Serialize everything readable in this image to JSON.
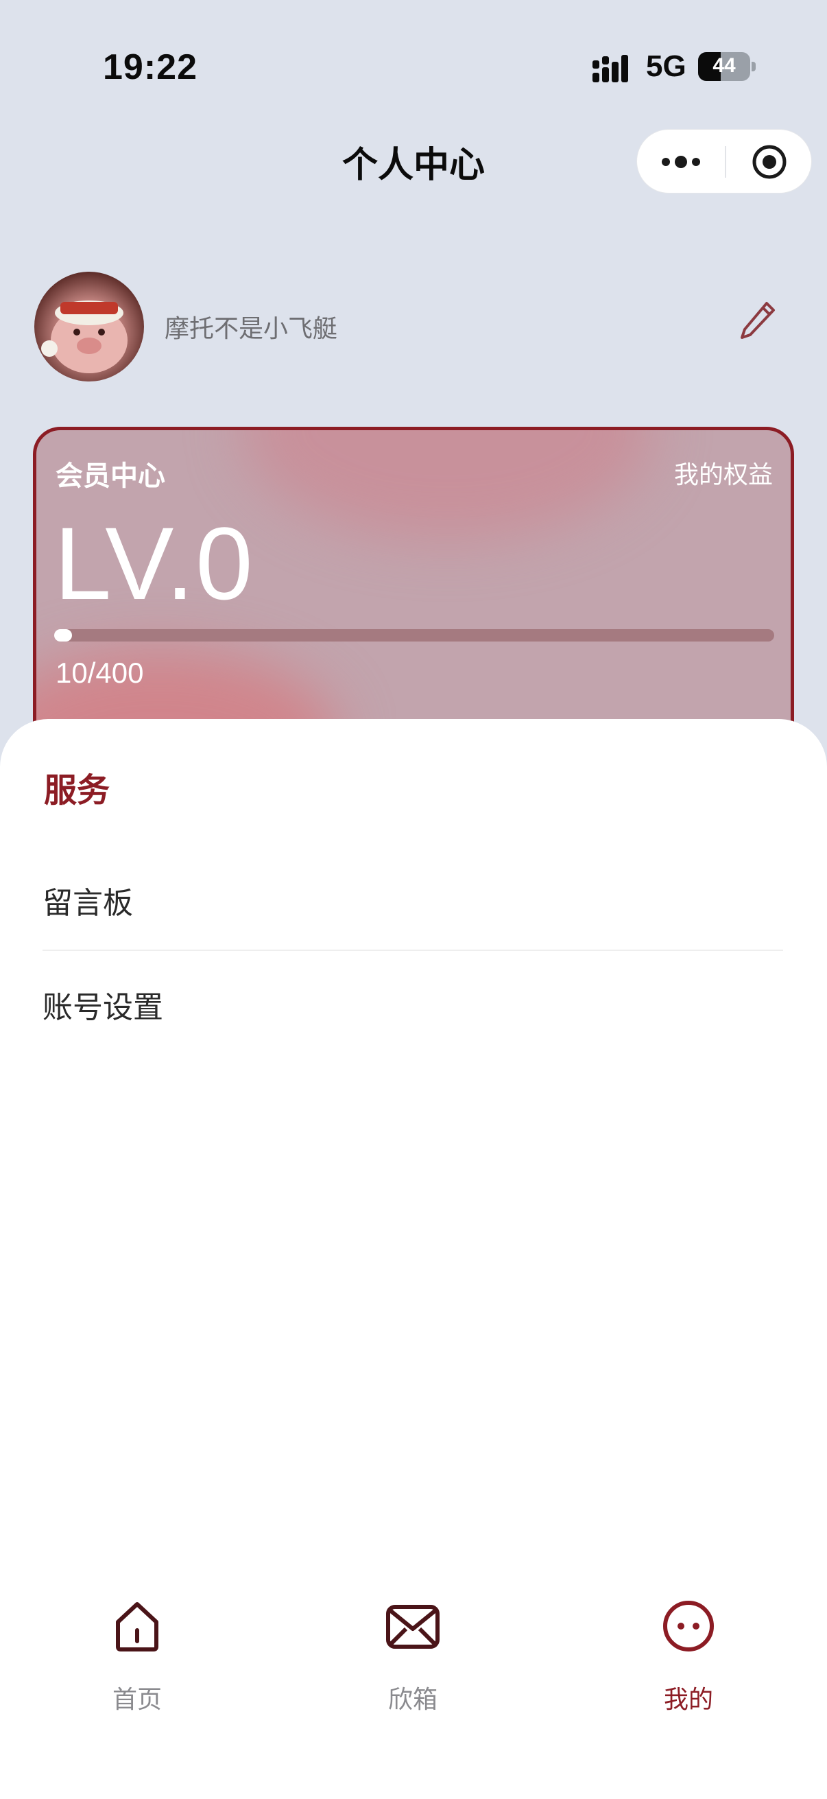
{
  "status_bar": {
    "time": "19:22",
    "network": "5G",
    "battery": "44",
    "battery_level": 0.44
  },
  "nav": {
    "title": "个人中心",
    "more_icon": "more-dots-icon",
    "close_icon": "target-close-icon"
  },
  "profile": {
    "nickname": "摩托不是小飞艇",
    "edit_icon": "pencil-icon"
  },
  "member_card": {
    "title": "会员中心",
    "benefits_link": "我的权益",
    "level": "LV.0",
    "points": "10/400",
    "progress": 0.025,
    "border_color": "#8c1c24"
  },
  "services": {
    "title": "服务",
    "items": [
      {
        "label": "留言板"
      },
      {
        "label": "账号设置"
      }
    ]
  },
  "tabbar": {
    "items": [
      {
        "label": "首页",
        "icon": "home-icon",
        "active": false
      },
      {
        "label": "欣箱",
        "icon": "mail-icon",
        "active": false
      },
      {
        "label": "我的",
        "icon": "face-icon",
        "active": true
      }
    ]
  },
  "colors": {
    "accent": "#8c1c24",
    "background": "#dde2ec"
  }
}
